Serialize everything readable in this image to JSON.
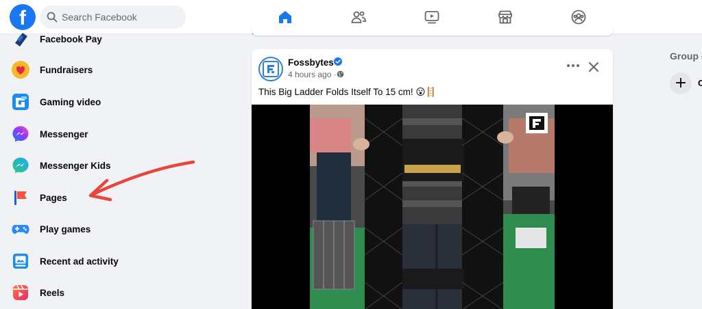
{
  "header": {
    "logo_letter": "f",
    "search_placeholder": "Search Facebook",
    "nav_tabs": [
      "home-icon",
      "friends-icon",
      "watch-icon",
      "marketplace-icon",
      "groups-icon"
    ],
    "active_tab": "home-icon",
    "accent_color": "#1877f2"
  },
  "sidebar": {
    "items": [
      {
        "label": "Facebook Pay",
        "icon": "facebook-pay-icon"
      },
      {
        "label": "Fundraisers",
        "icon": "fundraisers-icon"
      },
      {
        "label": "Gaming video",
        "icon": "gaming-video-icon"
      },
      {
        "label": "Messenger",
        "icon": "messenger-icon"
      },
      {
        "label": "Messenger Kids",
        "icon": "messenger-kids-icon"
      },
      {
        "label": "Pages",
        "icon": "pages-icon"
      },
      {
        "label": "Play games",
        "icon": "play-games-icon"
      },
      {
        "label": "Recent ad activity",
        "icon": "recent-ad-activity-icon"
      },
      {
        "label": "Reels",
        "icon": "reels-icon"
      }
    ],
    "annotation": "red-arrow pointing to Pages"
  },
  "post": {
    "author": "Fossbytes",
    "time": "4 hours ago ·",
    "caption": "This Big Ladder Folds Itself To 15 cm! 😮🪜",
    "more_label": "···"
  },
  "right_panel": {
    "title": "Group c",
    "item_initial": "C"
  }
}
